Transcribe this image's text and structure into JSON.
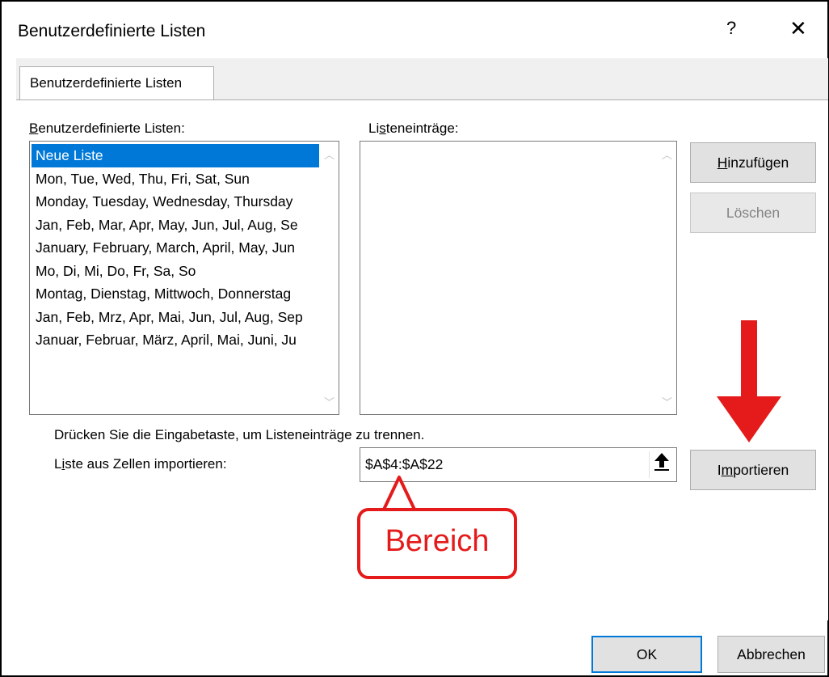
{
  "dialog": {
    "title": "Benutzerdefinierte Listen",
    "help_label": "?",
    "close_label": "✕"
  },
  "tab": {
    "label": "Benutzerdefinierte Listen"
  },
  "lists": {
    "label_first": "B",
    "label_rest": "enutzerdefinierte Listen:",
    "items": [
      {
        "label": "Neue Liste",
        "selected": true
      },
      {
        "label": "Mon, Tue, Wed, Thu, Fri, Sat, Sun",
        "selected": false
      },
      {
        "label": "Monday, Tuesday, Wednesday, Thursday",
        "selected": false
      },
      {
        "label": "Jan, Feb, Mar, Apr, May, Jun, Jul, Aug, Se",
        "selected": false
      },
      {
        "label": "January, February, March, April, May, Jun",
        "selected": false
      },
      {
        "label": "Mo, Di, Mi, Do, Fr, Sa, So",
        "selected": false
      },
      {
        "label": "Montag, Dienstag, Mittwoch, Donnerstag",
        "selected": false
      },
      {
        "label": "Jan, Feb, Mrz, Apr, Mai, Jun, Jul, Aug, Sep",
        "selected": false
      },
      {
        "label": "Januar, Februar, März, April, Mai, Juni, Ju",
        "selected": false
      }
    ]
  },
  "entries": {
    "label_a": "Li",
    "label_u": "s",
    "label_b": "teneinträge:"
  },
  "buttons": {
    "add_u": "H",
    "add_rest": "inzufügen",
    "delete": "Löschen",
    "import_a": "I",
    "import_u": "m",
    "import_b": "portieren"
  },
  "hint": "Drücken Sie die Eingabetaste, um Listeneinträge zu trennen.",
  "import": {
    "label_a": "L",
    "label_u": "i",
    "label_b": "ste aus Zellen importieren:",
    "range_value": "$A$4:$A$22"
  },
  "footer": {
    "ok": "OK",
    "cancel": "Abbrechen"
  },
  "annotations": {
    "callout_text": "Bereich",
    "accent_color": "#e51a1a"
  }
}
